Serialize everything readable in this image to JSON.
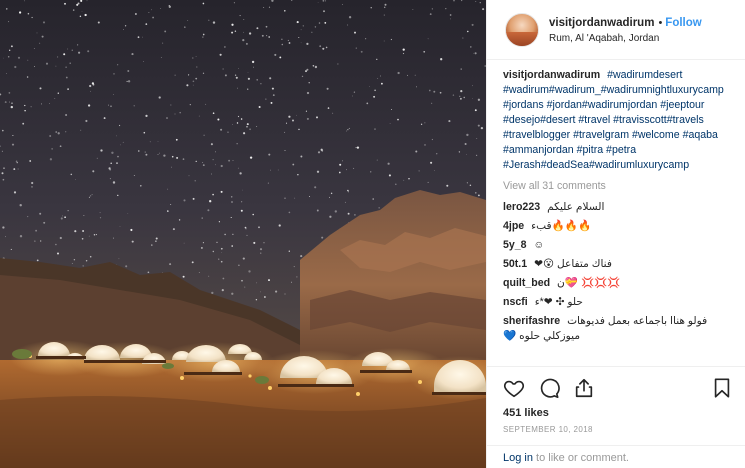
{
  "header": {
    "username": "visitjordanwadirum",
    "separator": "•",
    "follow_label": "Follow",
    "location": "Rum, Al 'Aqabah, Jordan"
  },
  "caption": {
    "username": "visitjordanwadirum",
    "hashtags": "#wadirumdesert #wadirum#wadirum_#wadirumnightluxurycamp #jordans #jordan#wadirumjordan #jeeptour #desejo#desert #travel #travisscott#travels #travelblogger #travelgram #welcome #aqaba #ammanjordan #pitra #petra #Jerash#deadSea#wadirumluxurycamp"
  },
  "view_all_label": "View all 31 comments",
  "comments": [
    {
      "username": "lero223",
      "text": "السلام عليكم"
    },
    {
      "username": "4jpe",
      "text": "🔥🔥🔥قبء"
    },
    {
      "username": "5y_8",
      "text": "☺"
    },
    {
      "username": "50t.1",
      "text": "فناك متفاعل 😮❤"
    },
    {
      "username": "quilt_bed",
      "text": "💢💢💢 💝ن"
    },
    {
      "username": "nscfi",
      "text": "حلو ✣ ❤*ء"
    },
    {
      "username": "sherifashre",
      "text": "فولو هناا باجماعه بعمل فديوهات ميوزكلي حلوه 💙"
    }
  ],
  "icons": [
    "heart-icon",
    "comment-icon",
    "share-icon",
    "bookmark-icon"
  ],
  "likes": "451 likes",
  "date": "SEPTEMBER 10, 2018",
  "login": {
    "link_label": "Log in",
    "suffix": " to like or comment."
  },
  "colors": {
    "link": "#3897f0",
    "hashtag": "#003569",
    "muted": "#999999",
    "text": "#262626"
  }
}
